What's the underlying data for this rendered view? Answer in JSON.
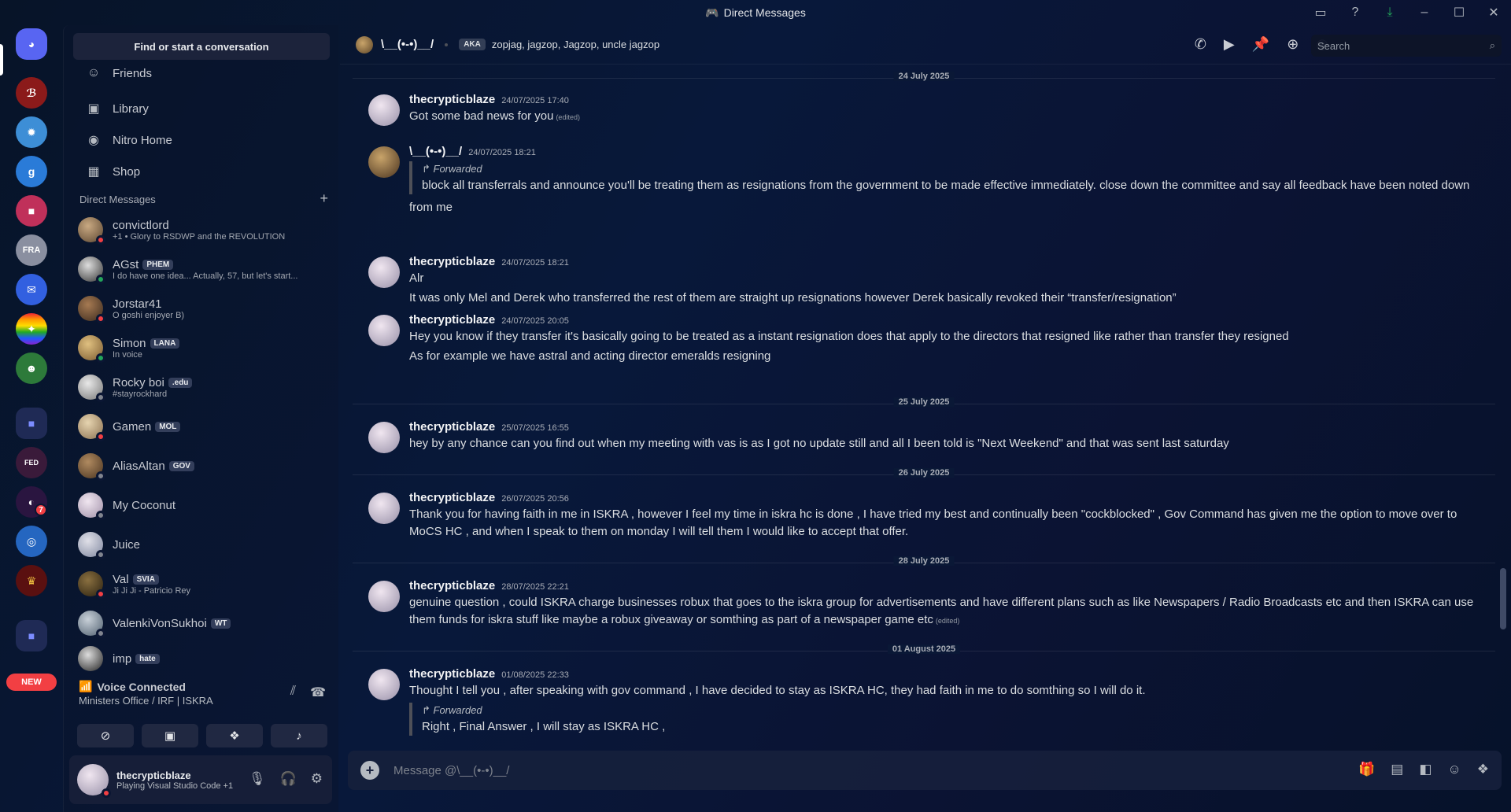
{
  "window": {
    "title": "Direct Messages"
  },
  "sidebar": {
    "find_placeholder": "Find or start a conversation",
    "nav": [
      {
        "label": "Friends",
        "icon": "friends-icon"
      },
      {
        "label": "Library",
        "icon": "library-icon"
      },
      {
        "label": "Nitro Home",
        "icon": "nitro-icon"
      },
      {
        "label": "Shop",
        "icon": "shop-icon"
      }
    ],
    "dm_header": "Direct Messages",
    "dms": [
      {
        "name": "convictlord",
        "tag": "",
        "sub": "+1 • Glory to RSDWP and the REVOLUTION",
        "status": "dnd"
      },
      {
        "name": "AGst",
        "tag": "PHEM",
        "sub": "I do have one idea... Actually, 57, but let's start...",
        "status": "online"
      },
      {
        "name": "Jorstar41",
        "tag": "",
        "sub": "O goshi enjoyer B)",
        "status": "dnd"
      },
      {
        "name": "Simon",
        "tag": "LANA",
        "sub": "In voice",
        "status": "online"
      },
      {
        "name": "Rocky boi",
        "tag": ".edu",
        "sub": "#stayrockhard",
        "status": "offline"
      },
      {
        "name": "Gamen",
        "tag": "MOL",
        "sub": "",
        "status": "dnd"
      },
      {
        "name": "AliasAltan",
        "tag": "GOV",
        "sub": "",
        "status": "offline"
      },
      {
        "name": "My Coconut",
        "tag": "",
        "sub": "",
        "status": "offline"
      },
      {
        "name": "Juice",
        "tag": "",
        "sub": "",
        "status": "offline"
      },
      {
        "name": "Val",
        "tag": "SVIA",
        "sub": "Ji Ji Ji - Patricio Rey",
        "status": "dnd"
      },
      {
        "name": "ValenkiVonSukhoi",
        "tag": "WT",
        "sub": "",
        "status": "offline"
      },
      {
        "name": "imp",
        "tag": "hate",
        "sub": "",
        "status": "offline"
      }
    ]
  },
  "rail": {
    "new_label": "NEW",
    "badge_count": "7"
  },
  "voice": {
    "title": "Voice Connected",
    "channel": "Ministers Office / IRF | ISKRA"
  },
  "user": {
    "name": "thecrypticblaze",
    "activity": "Playing Visual Studio Code +1"
  },
  "chat": {
    "name": "\\__(•-•)__/",
    "aka_label": "AKA",
    "aka": "zopjag, jagzop, Jagzop, uncle jagzop",
    "search_placeholder": "Search",
    "composer_placeholder": "Message @\\__(•-•)__/"
  },
  "messages": {
    "d1": "24 July 2025",
    "d2": "25 July 2025",
    "d3": "26 July 2025",
    "d4": "28 July 2025",
    "d5": "01 August 2025",
    "edited": "(edited)",
    "forwarded": "Forwarded",
    "m1": {
      "author": "thecrypticblaze",
      "ts": "24/07/2025 17:40",
      "text": "Got some bad news  for you"
    },
    "m2": {
      "author": "\\__(•-•)__/",
      "ts": "24/07/2025 18:21",
      "fwd": "block all transferrals and announce you'll be treating them as resignations from the government to be made effective immediately. close down the committee and say all feedback have been noted down",
      "text": "from me"
    },
    "m3": {
      "author": "thecrypticblaze",
      "ts": "24/07/2025 18:21",
      "text1": "Alr",
      "text2": "It was only Mel and Derek who transferred the rest of them are straight up resignations however Derek basically revoked their “transfer/resignation”"
    },
    "m4": {
      "author": "thecrypticblaze",
      "ts": "24/07/2025 20:05",
      "text1": "Hey you know if they transfer it's basically going to be treated as a instant resignation does that apply to the directors that resigned like rather than transfer they resigned",
      "text2": "As for example we have astral and acting director emeralds resigning"
    },
    "m5": {
      "author": "thecrypticblaze",
      "ts": "25/07/2025 16:55",
      "text": "hey by any chance can you find out when my meeting with vas is as I got no update still and all I been told is \"Next Weekend\" and that was sent last saturday"
    },
    "m6": {
      "author": "thecrypticblaze",
      "ts": "26/07/2025 20:56",
      "text": "Thank you for having faith in me in ISKRA , however I feel my time in iskra hc is done , I have tried my best and continually been \"cockblocked\" , Gov Command has given me the option to move over to MoCS HC , and when I speak to them on monday I will tell them I would like to accept that offer."
    },
    "m7": {
      "author": "thecrypticblaze",
      "ts": "28/07/2025 22:21",
      "text": "genuine question , could ISKRA charge businesses robux that goes to the iskra group for advertisements and have different plans such as like Newspapers / Radio Broadcasts etc and then ISKRA can use them funds for iskra stuff like maybe a robux giveaway or somthing as part of a newspaper game etc"
    },
    "m8": {
      "author": "thecrypticblaze",
      "ts": "01/08/2025 22:33",
      "text": "Thought I tell you , after speaking with gov command , I have decided to stay as ISKRA HC, they had faith in me to do somthing so I will do it.",
      "fwd": "Right , Final Answer , I will stay as ISKRA HC ,"
    }
  },
  "colors": {
    "accent": "#5865f2",
    "dnd": "#f23f43",
    "online": "#23a55a",
    "offline": "#80848e"
  }
}
